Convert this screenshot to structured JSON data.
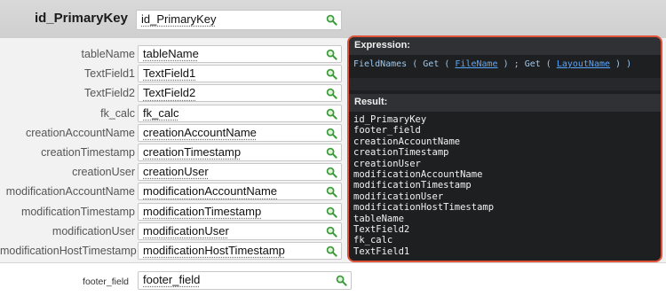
{
  "header": {
    "label": "id_PrimaryKey",
    "value": "id_PrimaryKey"
  },
  "rows": [
    {
      "label": "tableName",
      "value": "tableName"
    },
    {
      "label": "TextField1",
      "value": "TextField1"
    },
    {
      "label": "TextField2",
      "value": "TextField2"
    },
    {
      "label": "fk_calc",
      "value": "fk_calc"
    },
    {
      "label": "creationAccountName",
      "value": "creationAccountName"
    },
    {
      "label": "creationTimestamp",
      "value": "creationTimestamp"
    },
    {
      "label": "creationUser",
      "value": "creationUser"
    },
    {
      "label": "modificationAccountName",
      "value": "modificationAccountName"
    },
    {
      "label": "modificationTimestamp",
      "value": "modificationTimestamp"
    },
    {
      "label": "modificationUser",
      "value": "modificationUser"
    },
    {
      "label": "modificationHostTimestamp",
      "value": "modificationHostTimestamp"
    }
  ],
  "footer": {
    "label": "footer_field",
    "value": "footer_field"
  },
  "viewer": {
    "expression_heading": "Expression:",
    "expression": {
      "fn1": "FieldNames",
      "open1": " ( ",
      "fn2": "Get",
      "open2": " ( ",
      "ref1": "FileName",
      "close_sep": " ) ; ",
      "fn3": "Get",
      "open3": " ( ",
      "ref2": "LayoutName",
      "close_end": " ) )"
    },
    "result_heading": "Result:",
    "result_lines": [
      "id_PrimaryKey",
      "footer_field",
      "creationAccountName",
      "creationTimestamp",
      "creationUser",
      "modificationAccountName",
      "modificationTimestamp",
      "modificationUser",
      "modificationHostTimestamp",
      "tableName",
      "TextField2",
      "fk_calc",
      "TextField1"
    ]
  },
  "icons": {
    "field_search": "magnifier-icon"
  },
  "colors": {
    "viewer_border": "#e0533a",
    "viewer_bg": "#1d1f21",
    "magnifier": "#3a9a3a",
    "link": "#58a6ff"
  }
}
